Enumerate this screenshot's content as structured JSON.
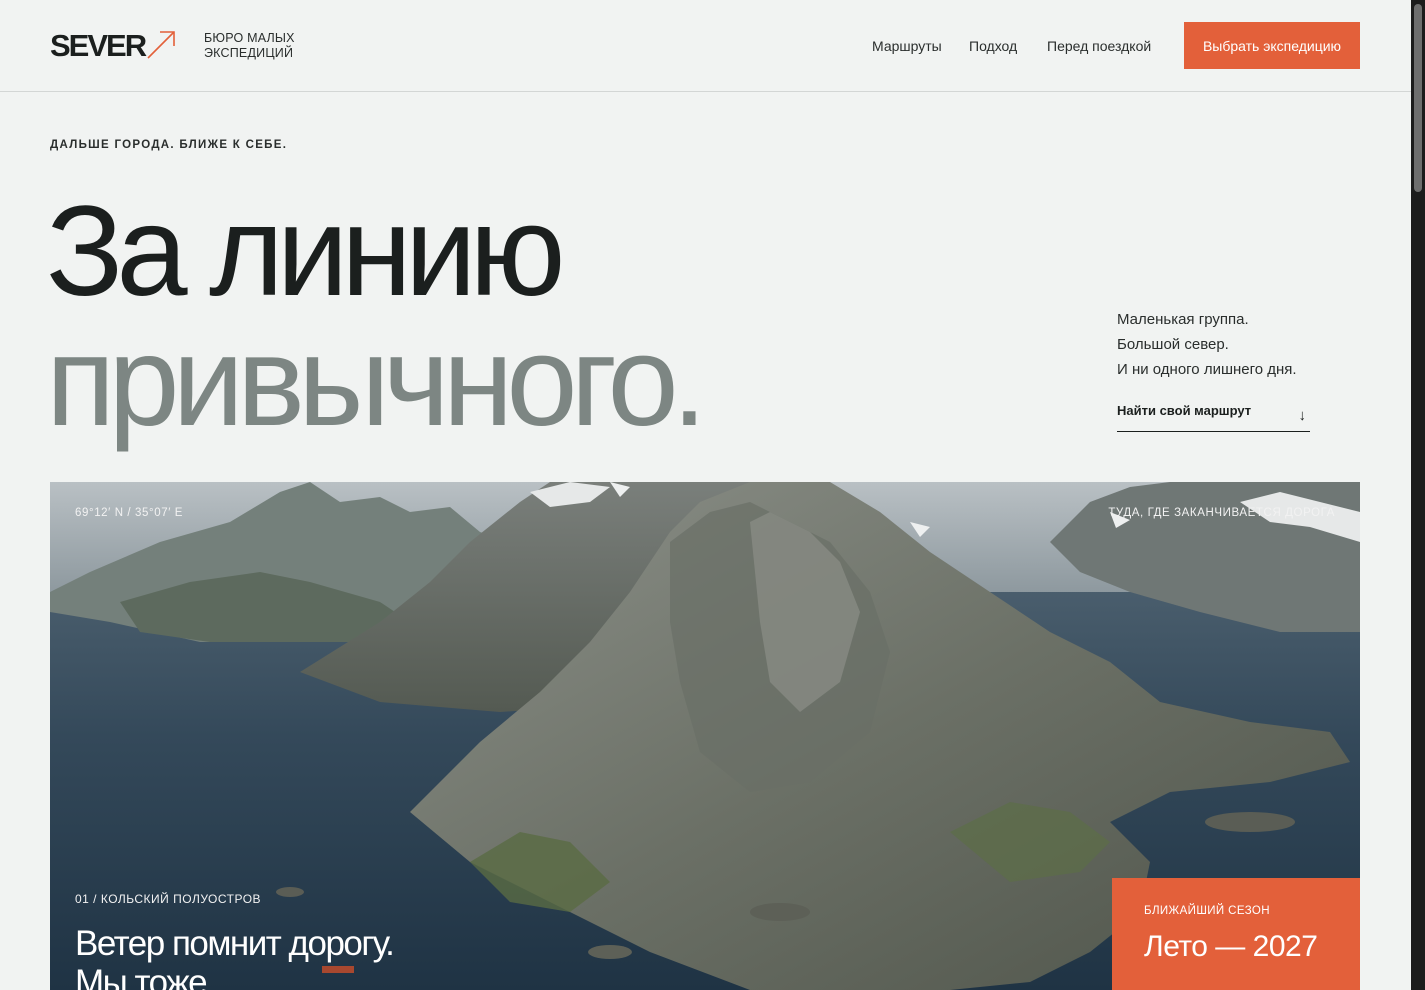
{
  "header": {
    "logo": "SEVER",
    "tagline": [
      "БЮРО МАЛЫХ",
      "ЭКСПЕДИЦИЙ"
    ],
    "nav": [
      "Маршруты",
      "Подход",
      "Перед поездкой"
    ],
    "cta": "Выбрать экспедицию"
  },
  "hero": {
    "eyebrow": "ДАЛЬШЕ ГОРОДА. БЛИЖЕ К СЕБЕ.",
    "title_line1": "За линию",
    "title_line2": "привычного.",
    "side_lines": [
      "Маленькая группа.",
      "Большой север.",
      "И ни одного лишнего дня."
    ],
    "find_link": "Найти свой маршрут",
    "find_arrow": "↓"
  },
  "photo": {
    "coordinates": "69°12′ N / 35°07′ E",
    "caption": "ТУДА, ГДЕ ЗАКАНЧИВАЕТСЯ ДОРОГА",
    "region": "01 / КОЛЬСКИЙ ПОЛУОСТРОВ",
    "title_lines": [
      "Ветер помнит дорогу.",
      "Мы тоже."
    ]
  },
  "season": {
    "label": "БЛИЖАЙШИЙ СЕЗОН",
    "value": "Лето — 2027"
  },
  "colors": {
    "accent": "#e3603a",
    "background": "#f1f3f2",
    "text": "#1b1f1e",
    "muted": "#7d8683"
  },
  "icons": [
    "arrow-up-right-icon",
    "arrow-down-icon"
  ]
}
